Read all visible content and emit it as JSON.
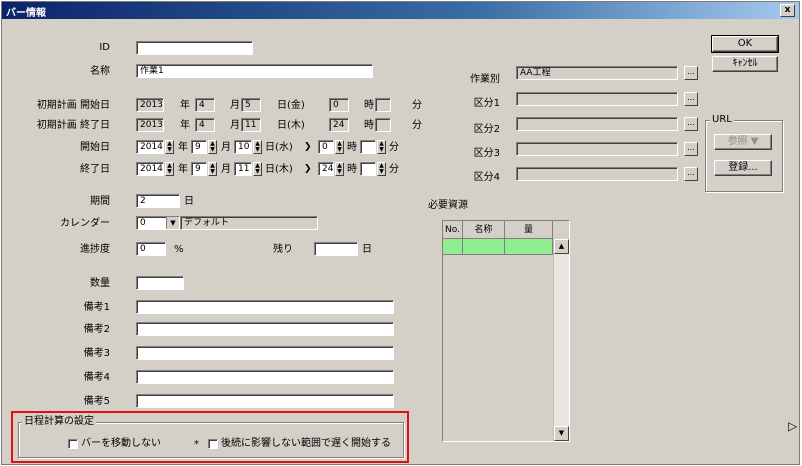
{
  "window": {
    "title": "バー情報",
    "close_label": "x"
  },
  "buttons": {
    "ok": "OK",
    "cancel": "ｷｬﾝｾﾙ",
    "reference": "参照 ▼",
    "register": "登録...",
    "ellipsis": "..."
  },
  "form": {
    "id_label": "ID",
    "id_value": "",
    "name_label": "名称",
    "name_value": "作業1",
    "plan_start_label": "初期計画 開始日",
    "plan_end_label": "初期計画 終了日",
    "start_label": "開始日",
    "end_label": "終了日",
    "plan_start": {
      "year": "2013",
      "month": "4",
      "day": "5",
      "dow": "日(金)",
      "hour": "0"
    },
    "plan_end": {
      "year": "2013",
      "month": "4",
      "day": "11",
      "dow": "日(木)",
      "hour": "24"
    },
    "start": {
      "year": "2014",
      "month": "9",
      "day": "10",
      "dow": "日(水)",
      "hour": "0"
    },
    "end": {
      "year": "2014",
      "month": "9",
      "day": "11",
      "dow": "日(木)",
      "hour": "24"
    },
    "unit_year": "年",
    "unit_month": "月",
    "unit_hour": "時",
    "unit_min": "分",
    "duration_label": "期間",
    "duration_value": "2",
    "duration_unit": "日",
    "calendar_label": "カレンダー",
    "calendar_value": "0",
    "calendar_name": "デフォルト",
    "progress_label": "進捗度",
    "progress_value": "0",
    "progress_unit": "%",
    "remaining_label": "残り",
    "remaining_value": "",
    "remaining_unit": "日",
    "quantity_label": "数量",
    "quantity_value": "",
    "notes": [
      {
        "label": "備考1",
        "value": ""
      },
      {
        "label": "備考2",
        "value": ""
      },
      {
        "label": "備考3",
        "value": ""
      },
      {
        "label": "備考4",
        "value": ""
      },
      {
        "label": "備考5",
        "value": ""
      }
    ]
  },
  "right": {
    "work_type_label": "作業別",
    "work_type_value": "AA工程",
    "categories": [
      {
        "label": "区分1",
        "value": ""
      },
      {
        "label": "区分2",
        "value": ""
      },
      {
        "label": "区分3",
        "value": ""
      },
      {
        "label": "区分4",
        "value": ""
      }
    ],
    "url_group_label": "URL",
    "resources_label": "必要資源",
    "resources_headers": [
      "No.",
      "名称",
      "量"
    ]
  },
  "schedule": {
    "group_label": "日程計算の設定",
    "check1": "バーを移動しない",
    "asterisk": "*",
    "check2": "後続に影響しない範囲で遅く開始する"
  },
  "colors": {
    "highlight": "#e01010",
    "grid_row": "#90ee90",
    "title_start": "#0a246a"
  }
}
